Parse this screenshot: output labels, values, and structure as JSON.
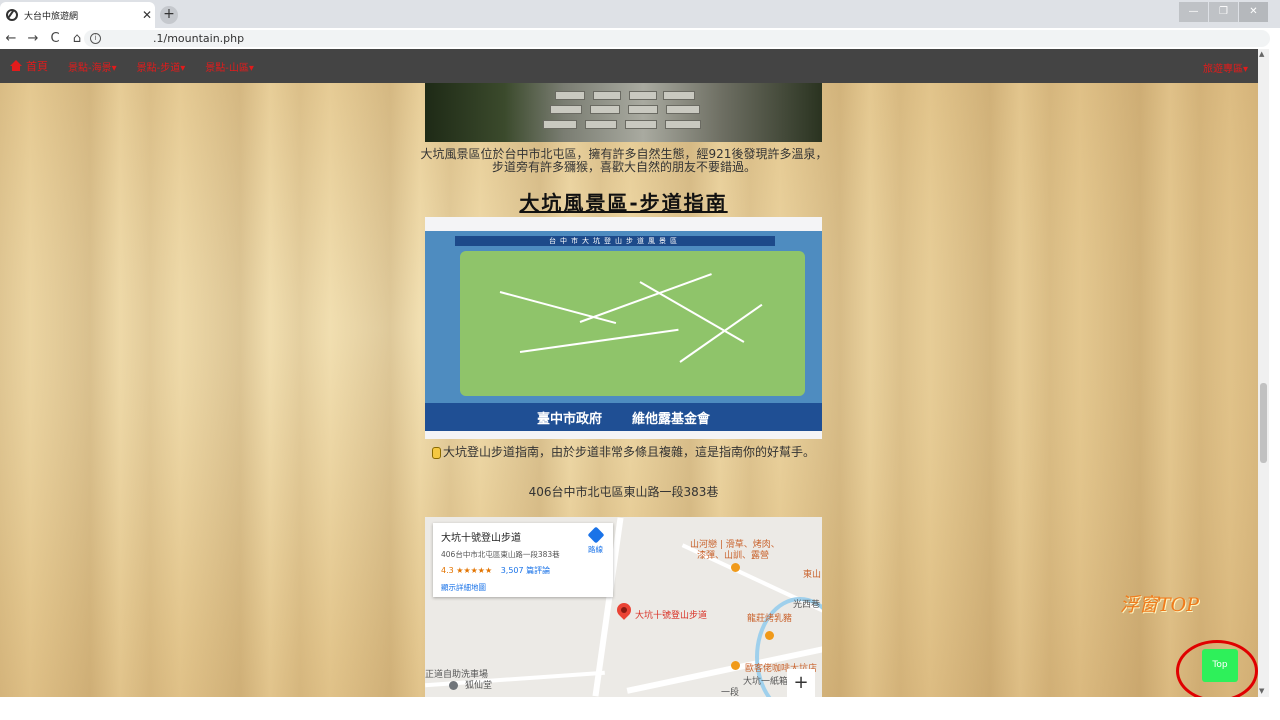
{
  "browser": {
    "tab_title": "大台中旅遊網",
    "tab_close": "✕",
    "newtab": "+",
    "url": ".1/mountain.php",
    "info": "i",
    "nav": {
      "back": "←",
      "forward": "→",
      "reload": "C",
      "home": "⌂"
    },
    "window": {
      "minimize": "—",
      "restore": "❐",
      "close": "✕"
    }
  },
  "site_nav": {
    "home": "首頁",
    "items": [
      "景點-海景▾",
      "景點-步道▾",
      "景點-山區▾"
    ],
    "right": "旅遊專區▾"
  },
  "content": {
    "description": "大坑風景區位於台中市北屯區，擁有許多自然生態，經921後發現許多溫泉，步道旁有許多獼猴，喜歡大自然的朋友不要錯過。",
    "heading": "大坑風景區-步道指南",
    "map_board": {
      "title": "台中市大坑登山步道風景區",
      "footer_left": "臺中市政府",
      "footer_right": "維他露基金會"
    },
    "caption": "大坑登山步道指南，由於步道非常多條且複雜，這是指南你的好幫手。",
    "address": "406台中市北屯區東山路一段383巷"
  },
  "gmap": {
    "place_name": "大坑十號登山步道",
    "place_address": "406台中市北屯區東山路一段383巷",
    "rating": "4.3",
    "stars": "★★★★★",
    "reviews": "3,507 篇評論",
    "larger_map": "顯示詳細地圖",
    "directions": "路線",
    "labels": {
      "pin_label": "大坑十號登山步道",
      "poi1": "山河戀 | 滑草、烤肉、",
      "poi1b": "漆彈、山訓、露營",
      "poi2": "東山",
      "poi3": "光西巷",
      "poi4": "龍莊烤乳豬",
      "poi5": "歐客佬咖啡大坑店",
      "poi6": "大坑一紙箱",
      "poi7": "正道自助洗車場",
      "poi8": "狐仙堂",
      "road1": "一段"
    },
    "zoom_in": "+"
  },
  "floating": {
    "label": "浮窗TOP",
    "top_button": "Top"
  },
  "colors": {
    "nav_bg": "#444444",
    "nav_text": "#e21b1b",
    "top_button": "#2ef05a",
    "float_label": "#f07b1b",
    "highlight_ring": "#e00000"
  }
}
